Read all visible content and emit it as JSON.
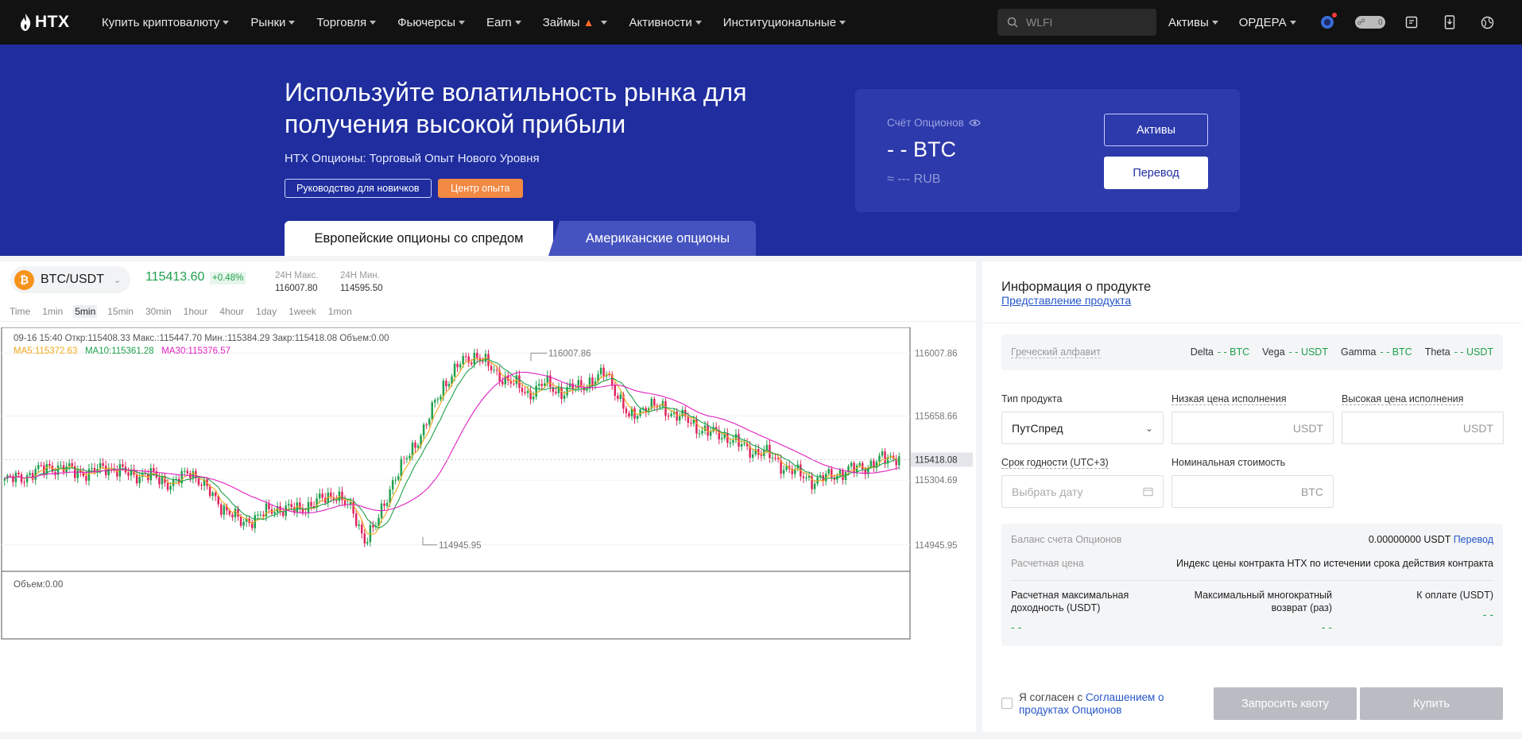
{
  "nav": {
    "logo": "HTX",
    "links": [
      {
        "label": "Купить криптовалюту"
      },
      {
        "label": "Рынки"
      },
      {
        "label": "Торговля"
      },
      {
        "label": "Фьючерсы"
      },
      {
        "label": "Earn"
      },
      {
        "label": "Займы"
      },
      {
        "label": "Активности"
      },
      {
        "label": "Институциональные"
      }
    ],
    "search_placeholder": "WLFI",
    "assets": "Активы",
    "orders": "ОРДЕРА",
    "toggle_count": "0"
  },
  "hero": {
    "title": "Используйте волатильность рынка для получения высокой прибыли",
    "subtitle": "HTX Опционы: Торговый Опыт Нового Уровня",
    "guide_button": "Руководство для новичков",
    "center_button": "Центр опыта",
    "account": {
      "label": "Счёт Опционов",
      "value": "- - BTC",
      "rub": "≈ --- RUB",
      "assets_button": "Активы",
      "transfer_button": "Перевод"
    },
    "tabs": [
      "Европейские опционы со спредом",
      "Американские опционы"
    ]
  },
  "ticker": {
    "pair": "BTC/USDT",
    "coin_symbol": "₿",
    "price": "115413.60",
    "change": "+0.48%",
    "high_label": "24Н Макс.",
    "high": "116007.80",
    "low_label": "24Н Мин.",
    "low": "114595.50"
  },
  "timeframes": [
    "Time",
    "1min",
    "5min",
    "15min",
    "30min",
    "1hour",
    "4hour",
    "1day",
    "1week",
    "1mon"
  ],
  "active_timeframe": "5min",
  "ohlc_text": "09-16 15:40  Откр:115408.33  Макс.:115447.70  Мин.:115384.29  Закр:115418.08  Объем:0.00",
  "ma": {
    "ma5": "MA5:115372.63",
    "ma10": "MA10:115361.28",
    "ma30": "MA30:115376.57"
  },
  "volume_label": "Объем:0.00",
  "chart_data": {
    "type": "candlestick",
    "ylim": [
      114800,
      116150
    ],
    "y_ticks": [
      "116007.86",
      "115658.66",
      "115304.69",
      "114945.95"
    ],
    "last_price": "115418.08",
    "max_label": "116007.86",
    "min_label": "114945.95",
    "ma_colors": {
      "ma5": "#f0a81d",
      "ma10": "#1fa04c",
      "ma30": "#e020c0"
    },
    "up_color": "#1fa04c",
    "down_color": "#e0245e"
  },
  "product": {
    "title": "Информация о продукте",
    "link": "Представление продукта",
    "greek_label": "Греческий алфавит",
    "greeks": [
      {
        "name": "Delta",
        "value": "- - BTC"
      },
      {
        "name": "Vega",
        "value": "- - USDT"
      },
      {
        "name": "Gamma",
        "value": "- - BTC"
      },
      {
        "name": "Theta",
        "value": "- - USDT"
      }
    ],
    "type_label": "Тип продукта",
    "type_value": "ПутСпред",
    "low_strike_label": "Низкая цена исполнения",
    "high_strike_label": "Высокая цена исполнения",
    "unit_usdt": "USDT",
    "expiry_label": "Срок годности (UTC+3)",
    "expiry_placeholder": "Выбрать дату",
    "nominal_label": "Номинальная стоимость",
    "unit_btc": "BTC",
    "balance_label": "Баланс счета Опционов",
    "balance_value": "0.00000000 USDT",
    "balance_link": "Перевод",
    "settle_label": "Расчетная цена",
    "settle_value": "Индекс цены контракта HTX по истечении срока действия контракта",
    "max_yield_label": "Расчетная максимальная доходность (USDT)",
    "max_mult_label": "Максимальный многократный возврат (раз)",
    "pay_label": "К оплате (USDT)",
    "dash": "- -",
    "agree_prefix": "Я согласен с ",
    "agree_link": "Соглашением о продуктах Опционов",
    "quote_button": "Запросить квоту",
    "buy_button": "Купить"
  }
}
